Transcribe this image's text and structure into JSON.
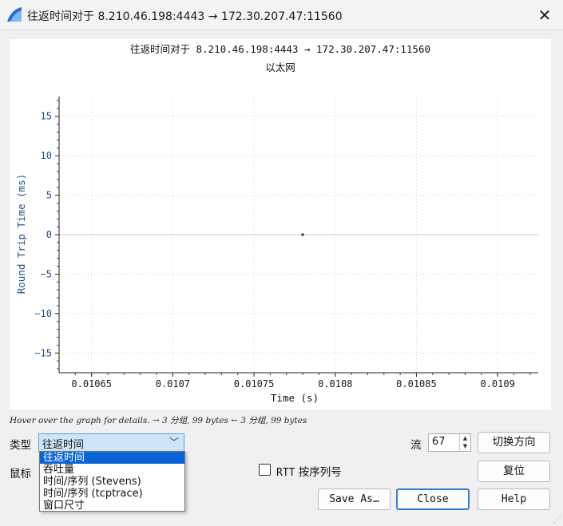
{
  "window": {
    "title": "往返时间对于 8.210.46.198:4443 → 172.30.207.47:11560",
    "close_glyph": "✕"
  },
  "chart_data": {
    "type": "scatter",
    "title": "往返时间对于 8.210.46.198:4443 → 172.30.207.47:11560",
    "subtitle": "以太网",
    "xlabel": "Time (s)",
    "ylabel": "Round Trip Time (ms)",
    "xlim": [
      0.01063,
      0.010925
    ],
    "ylim": [
      -17.5,
      17.5
    ],
    "xticks": [
      0.01065,
      0.0107,
      0.01075,
      0.0108,
      0.01085,
      0.0109
    ],
    "xtick_labels": [
      "0.01065",
      "0.0107",
      "0.01075",
      "0.0108",
      "0.01085",
      "0.0109"
    ],
    "yticks": [
      -15,
      -10,
      -5,
      0,
      5,
      10,
      15
    ],
    "ytick_labels": [
      "−15",
      "−10",
      "−5",
      "0",
      "5",
      "10",
      "15"
    ],
    "grid": true,
    "series": [
      {
        "x": [
          0.01078
        ],
        "y": [
          0
        ],
        "color": "#1f4e8c"
      }
    ]
  },
  "hint": "Hover over the graph for details. → 3 分组, 99 bytes ← 3 分组, 99 bytes",
  "controls": {
    "type_label": "类型",
    "type_selected": "往返时间",
    "type_options": [
      "往返时间",
      "吞吐量",
      "时间/序列 (Stevens)",
      "时间/序列 (tcptrace)",
      "窗口尺寸"
    ],
    "mouse_label": "鼠标",
    "stream_label": "流",
    "stream_value": "67",
    "switch_direction": "切换方向",
    "reset": "复位",
    "rtt_checkbox_label_a": "RTT",
    "rtt_checkbox_label_b": "按序列号",
    "rtt_checked": false,
    "save_as": "Save As…",
    "close": "Close",
    "help": "Help"
  }
}
